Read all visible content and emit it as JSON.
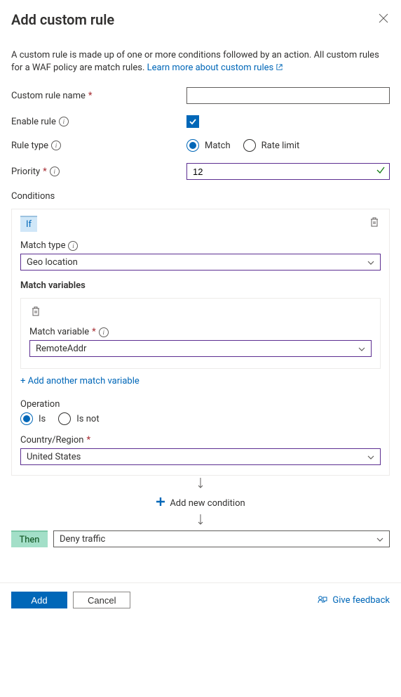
{
  "header": {
    "title": "Add custom rule"
  },
  "intro": {
    "text": "A custom rule is made up of one or more conditions followed by an action. All custom rules for a WAF policy are match rules. ",
    "link": "Learn more about custom rules"
  },
  "form": {
    "custom_rule_name_label": "Custom rule name",
    "custom_rule_name_value": "",
    "enable_rule_label": "Enable rule",
    "rule_type_label": "Rule type",
    "rule_type_options": {
      "match": "Match",
      "rate_limit": "Rate limit"
    },
    "priority_label": "Priority",
    "priority_value": "12"
  },
  "conditions": {
    "section_label": "Conditions",
    "if_label": "If",
    "match_type_label": "Match type",
    "match_type_value": "Geo location",
    "match_variables_label": "Match variables",
    "match_variable_label": "Match variable",
    "match_variable_value": "RemoteAddr",
    "add_variable": "+ Add another match variable",
    "operation_label": "Operation",
    "operation_options": {
      "is": "Is",
      "is_not": "Is not"
    },
    "country_label": "Country/Region",
    "country_value": "United States",
    "add_condition": "Add new condition",
    "then_label": "Then",
    "then_value": "Deny traffic"
  },
  "footer": {
    "add": "Add",
    "cancel": "Cancel",
    "feedback": "Give feedback"
  }
}
